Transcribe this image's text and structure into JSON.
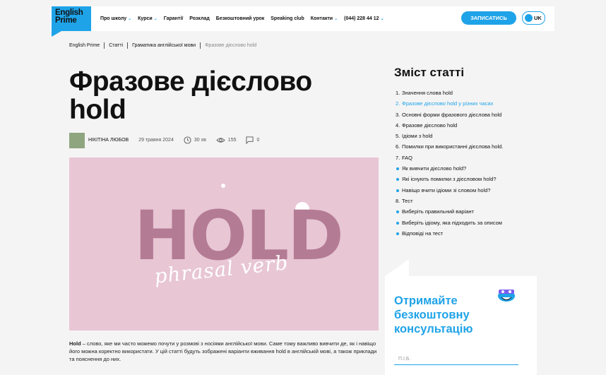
{
  "header": {
    "logo_line1": "English",
    "logo_line2": "Prime",
    "nav": [
      {
        "label": "Про школу",
        "dropdown": true
      },
      {
        "label": "Курси",
        "dropdown": true
      },
      {
        "label": "Гарантії",
        "dropdown": false
      },
      {
        "label": "Розклад",
        "dropdown": false
      },
      {
        "label": "Безкоштовний урок",
        "dropdown": false
      },
      {
        "label": "Speaking club",
        "dropdown": false
      },
      {
        "label": "Контакти",
        "dropdown": true
      },
      {
        "label": "(044) 228 44 12",
        "dropdown": true
      }
    ],
    "signup_label": "ЗАПИСАТИСЬ",
    "lang_label": "UK"
  },
  "breadcrumbs": [
    "English Prime",
    "Статті",
    "Граматика англійської мови",
    "Фразове дієслово hold"
  ],
  "article": {
    "title": "Фразове дієслово hold",
    "author": "НІКІТІНА ЛЮБОВ",
    "date": "29 травня 2024",
    "read_time": "30 хв",
    "views": "155",
    "comments": "0",
    "hero_word": "HOLD",
    "hero_script": "phrasal verb",
    "intro_bold": "Hold",
    "intro_text": " – слово, яке ми часто можемо почути у розмові з носіями англійської мови. Саме тому важливо вивчити де, як і навіщо його можна коректно використати. У цій статті будуть зображені варіанти вживання hold в англійській мові, а також приклади та пояснення до них."
  },
  "toc": {
    "title": "Зміст статті",
    "items": [
      {
        "num": "1.",
        "label": "Значення слова hold",
        "active": false
      },
      {
        "num": "2.",
        "label": "Фразове дієслово hold у різних часах",
        "active": true
      },
      {
        "num": "3.",
        "label": "Основні форми фразового дієслова hold",
        "active": false
      },
      {
        "num": "4.",
        "label": "Фразове дієслово hold",
        "active": false
      },
      {
        "num": "5.",
        "label": "Ідіоми з hold",
        "active": false
      },
      {
        "num": "6.",
        "label": "Помилки при використанні дієслова hold.",
        "active": false
      },
      {
        "num": "7.",
        "label": "FAQ",
        "active": false
      },
      {
        "num": "",
        "label": "Як вивчити дієслово hold?",
        "active": false
      },
      {
        "num": "",
        "label": "Які існують помилки з дієсловом hold?",
        "active": false
      },
      {
        "num": "",
        "label": "Навіщо вчити ідіоми зі словом hold?",
        "active": false
      },
      {
        "num": "8.",
        "label": "Тест",
        "active": false
      },
      {
        "num": "",
        "label": "Виберіть правильний варіант",
        "active": false
      },
      {
        "num": "",
        "label": "Виберіть ідіому, яка підходить за описом",
        "active": false
      },
      {
        "num": "",
        "label": "Відповіді на тест",
        "active": false
      }
    ]
  },
  "cta": {
    "title_line1": "Отримайте",
    "title_line2": "безкоштовну",
    "title_line3": "консультацію",
    "name_placeholder": "П.І.Б."
  },
  "colors": {
    "accent": "#1fa3e8",
    "hero_bg": "#e8c6d4",
    "hero_text": "#b47b95"
  }
}
